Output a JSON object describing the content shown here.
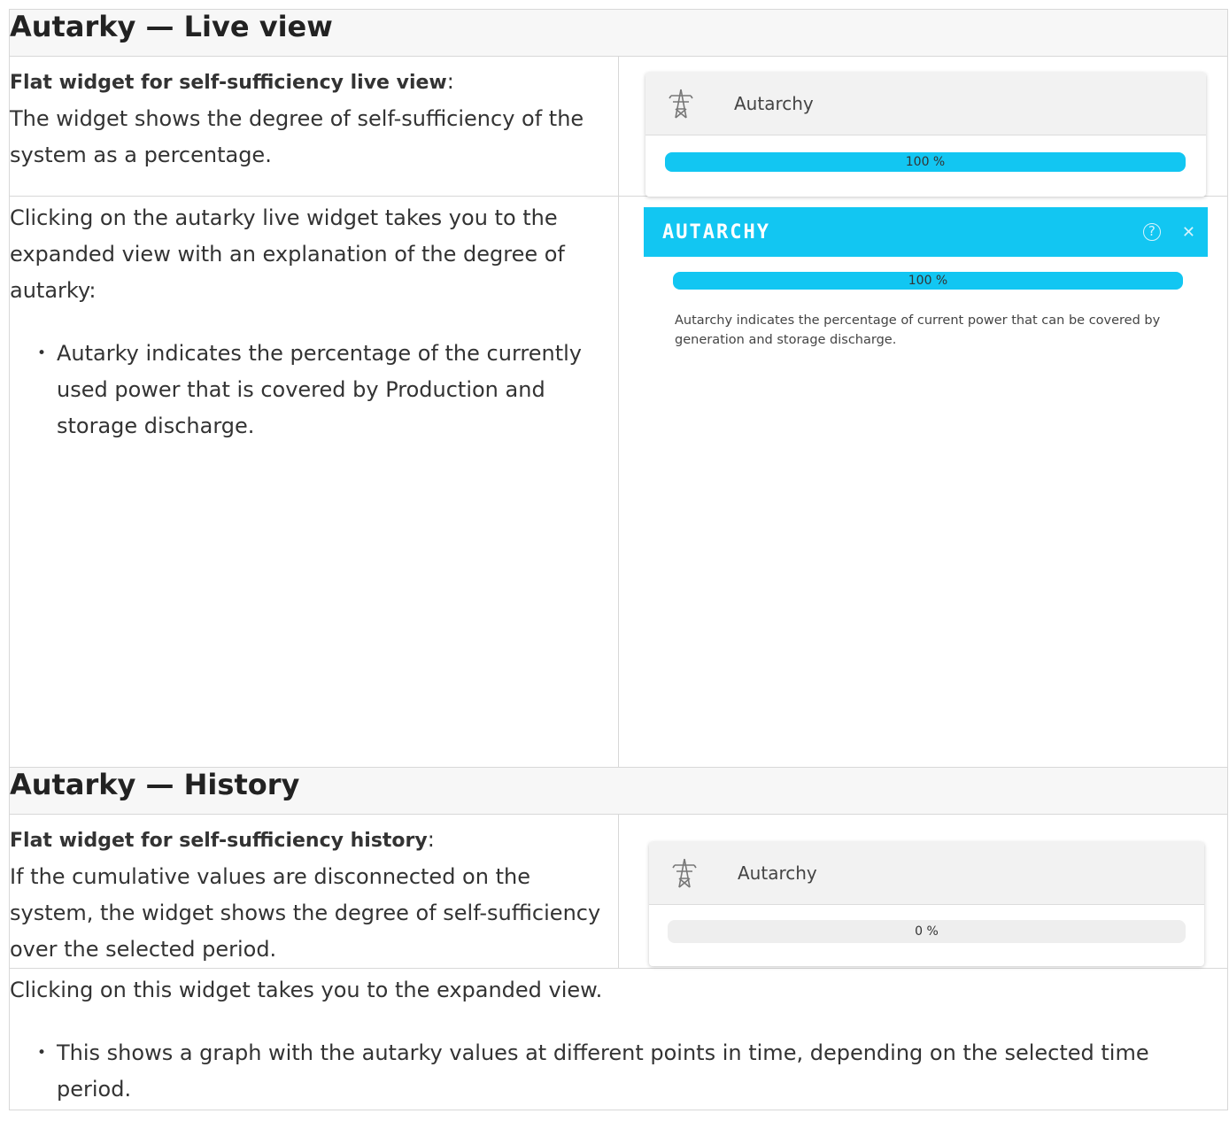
{
  "section1": {
    "heading": "Autarky — Live view",
    "row1": {
      "bold": "Flat widget for self-sufficiency live view",
      "colon": ":",
      "text": "The widget shows the degree of self-sufficiency of the system as a percentage."
    },
    "widget": {
      "title": "Autarchy",
      "icon": "power-tower-icon",
      "value_label": "100 %",
      "value": 1.0
    },
    "row2": {
      "text": "Clicking on the autarky live widget takes you to the expanded view with an explanation of the degree of autarky:",
      "bullet": "Autarky indicates the percentage of the currently used power that is covered by Production and storage discharge."
    },
    "modal": {
      "title": "AUTARCHY",
      "help_icon": "help-icon",
      "close_icon": "close-icon",
      "value_label": "100 %",
      "value": 1.0,
      "description": "Autarchy indicates the percentage of current power that can be covered by generation and storage discharge."
    }
  },
  "section2": {
    "heading": "Autarky — History",
    "row1": {
      "bold": "Flat widget for self-sufficiency history",
      "colon": ":",
      "text": "If the cumulative values are disconnected on the system, the widget shows the degree of self-sufficiency over the selected period."
    },
    "widget": {
      "title": "Autarchy",
      "icon": "power-tower-icon",
      "value_label": "0 %",
      "value": 0.0
    },
    "row2": {
      "text": "Clicking on this widget takes you to the expanded view.",
      "bullet": "This shows a graph with the autarky values at different points in time, depending on the selected time period."
    }
  },
  "colors": {
    "accent": "#12c6f2",
    "bar_bg": "#eeeeee",
    "header_bg": "#f7f7f7"
  }
}
